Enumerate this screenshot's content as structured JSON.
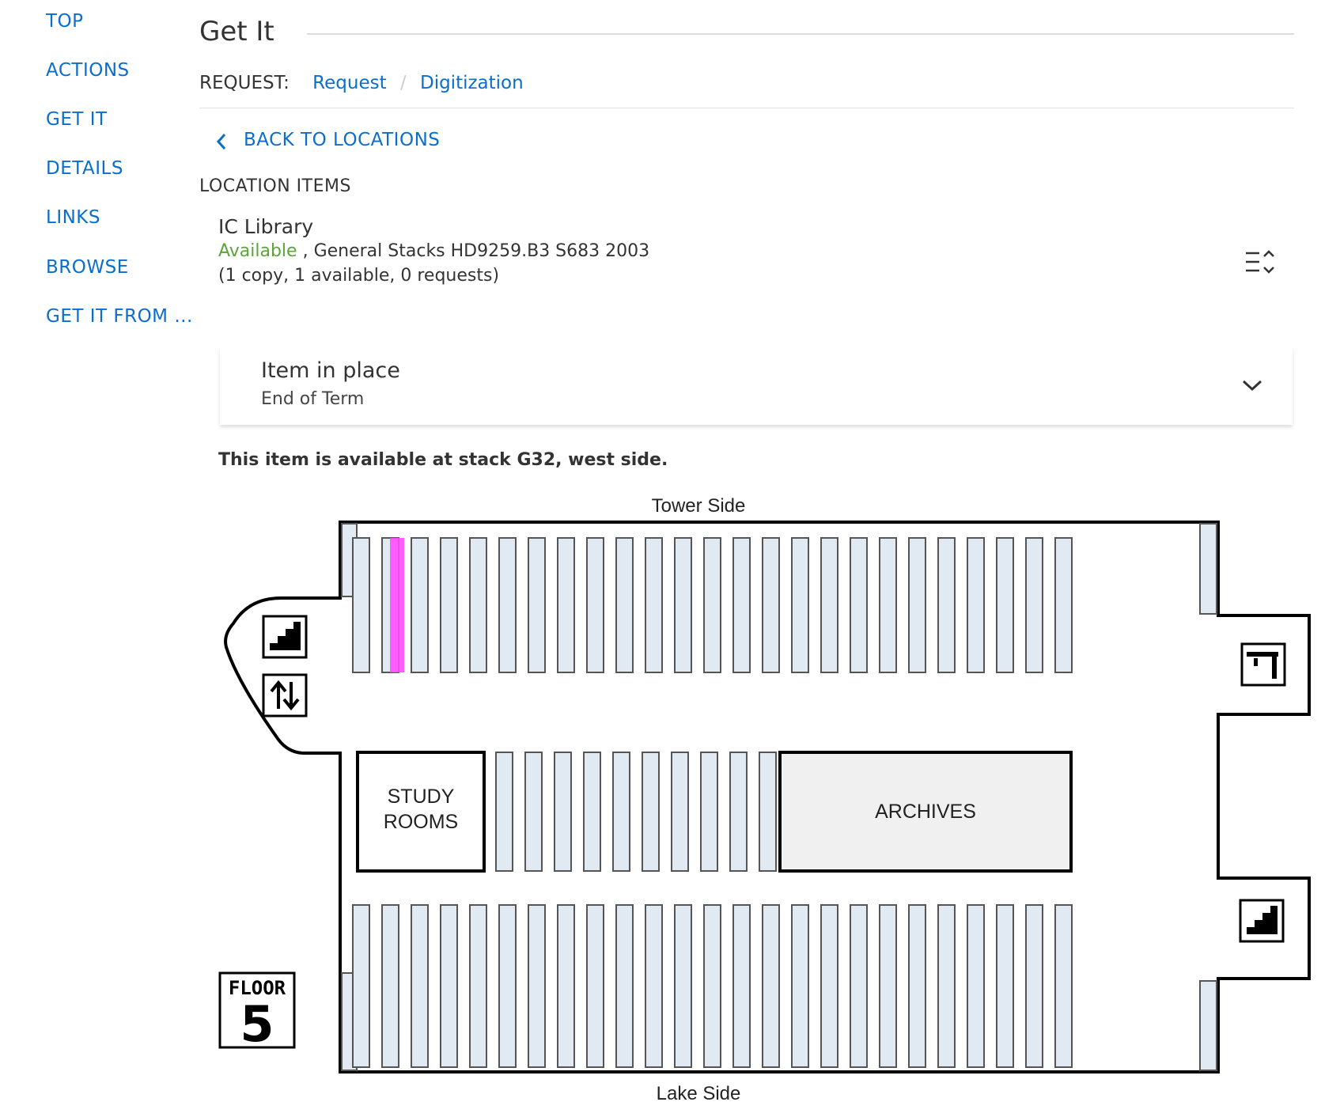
{
  "sidenav": {
    "items": [
      "TOP",
      "ACTIONS",
      "GET IT",
      "DETAILS",
      "LINKS",
      "BROWSE",
      "GET IT FROM ..."
    ]
  },
  "section": {
    "title": "Get It"
  },
  "request": {
    "label": "REQUEST:",
    "options": [
      "Request",
      "Digitization"
    ],
    "separator": "/"
  },
  "back_link": {
    "label": "BACK TO LOCATIONS",
    "icon": "chevron-left-icon"
  },
  "location_items": {
    "heading": "LOCATION ITEMS",
    "library": "IC Library",
    "availability": "Available",
    "location_detail": ", General Stacks HD9259.B3 S683 2003",
    "copies": "(1 copy, 1 available, 0 requests)",
    "sort_icon": "sort-icon"
  },
  "item": {
    "status": "Item in place",
    "policy": "End of Term",
    "expand_icon": "chevron-down-icon"
  },
  "availability_message": "This item is available at stack G32, west side.",
  "floor_map": {
    "top_label": "Tower Side",
    "bottom_label": "Lake Side",
    "study_rooms_line1": "STUDY",
    "study_rooms_line2": "ROOMS",
    "archives": "ARCHIVES",
    "floor_word": "FLOOR",
    "floor_number": "5",
    "highlight_color": "#ff4dff",
    "shelf_color": "#e1e9f3",
    "icons": [
      "stairs-icon",
      "elevator-icon",
      "restroom-sink-icon",
      "stairs-icon"
    ]
  },
  "colors": {
    "link": "#0a6ecd",
    "available": "#5aa53a"
  }
}
